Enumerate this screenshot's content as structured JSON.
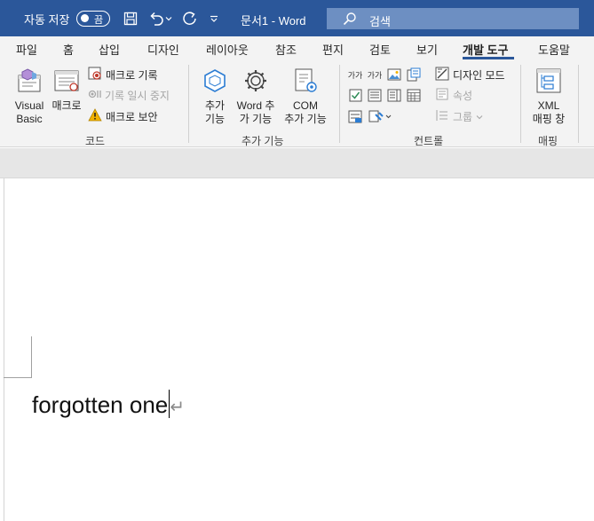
{
  "titlebar": {
    "autosave_label": "자동 저장",
    "autosave_toggle": "끔",
    "doc_title": "문서1  -  Word",
    "search_placeholder": "검색",
    "icons": [
      "save-icon",
      "undo-icon",
      "redo-icon",
      "customize-qat-icon"
    ]
  },
  "tabs": {
    "items": [
      "파일",
      "홈",
      "삽입",
      "디자인",
      "레이아웃",
      "참조",
      "편지",
      "검토",
      "보기",
      "개발 도구",
      "도움말"
    ],
    "active": "개발 도구"
  },
  "ribbon": {
    "code": {
      "label": "코드",
      "visual_basic": [
        "Visual",
        "Basic"
      ],
      "macros": "매크로",
      "record_macro": "매크로 기록",
      "pause_recording": "기록 일시 중지",
      "macro_security": "매크로 보안"
    },
    "addins": {
      "label": "추가 기능",
      "addins_btn": [
        "추가",
        "기능"
      ],
      "word_addins": [
        "Word 추",
        "가 기능"
      ],
      "com_addins": [
        "COM",
        "추가 기능"
      ]
    },
    "controls": {
      "label": "컨트롤",
      "rich_text": "가가",
      "plain_text": "가가",
      "design_mode": "디자인 모드",
      "properties": "속성",
      "group": "그룹"
    },
    "mapping": {
      "label": "매핑",
      "xml_pane": [
        "XML",
        "매핑 창"
      ]
    }
  },
  "document": {
    "text": "forgotten one",
    "paragraph_mark": "↵"
  },
  "colors": {
    "titlebar": "#2b579a",
    "ribbon_bg": "#f3f3f3",
    "accent": "#2b579a"
  }
}
